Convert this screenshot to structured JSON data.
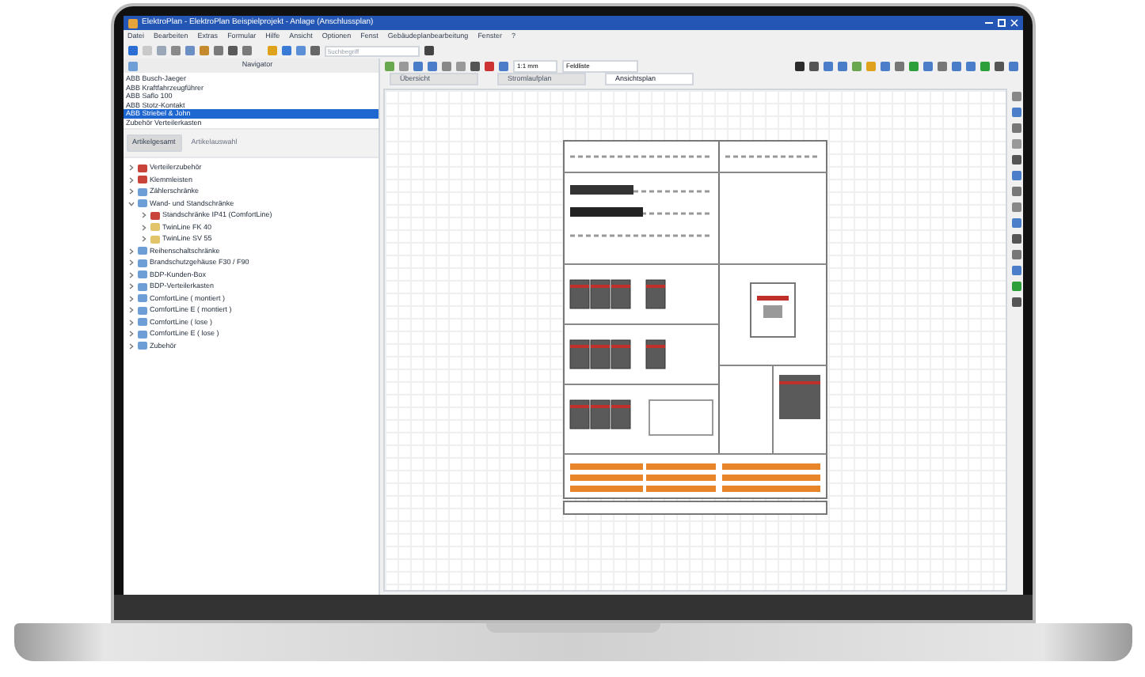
{
  "window": {
    "title": "ElektroPlan - ElektroPlan Beispielprojekt - Anlage (Anschlussplan)"
  },
  "menu": [
    "Datei",
    "Bearbeiten",
    "Extras",
    "Formular",
    "Hilfe",
    "Ansicht",
    "Optionen",
    "Fenst",
    "Gebäudeplanbearbeitung",
    "Fenster",
    "?"
  ],
  "toolbar": {
    "field_placeholder": "Suchbegriff",
    "scale": "1:1 mm",
    "view": "Feldliste"
  },
  "navigator": {
    "title": "Navigator",
    "items": [
      {
        "label": "ABB Busch-Jaeger",
        "selected": false
      },
      {
        "label": "ABB Kraftfahrzeugführer",
        "selected": false
      },
      {
        "label": "ABB Saflo 100",
        "selected": false
      },
      {
        "label": "ABB Stotz-Kontakt",
        "selected": false
      },
      {
        "label": "ABB Striebel & John",
        "selected": true
      },
      {
        "label": "Zubehör Verteilerkasten",
        "selected": false
      }
    ],
    "buttons": [
      {
        "label": "Artikelgesamt",
        "disabled": false
      },
      {
        "label": "Artikelauswahl",
        "disabled": true
      }
    ],
    "tree": [
      {
        "label": "Verteilerzubehör",
        "kind": "component",
        "expanded": false
      },
      {
        "label": "Klemmleisten",
        "kind": "component",
        "expanded": false
      },
      {
        "label": "Zählerschränke",
        "kind": "folder",
        "expanded": false
      },
      {
        "label": "Wand- und Standschränke",
        "kind": "folder",
        "expanded": true,
        "children": [
          {
            "label": "Standschränke IP41 (ComfortLine)",
            "kind": "component",
            "expanded": false
          },
          {
            "label": "TwinLine FK 40",
            "kind": "module",
            "expanded": false
          },
          {
            "label": "TwinLine SV 55",
            "kind": "module",
            "expanded": false
          }
        ]
      },
      {
        "label": "Reihenschaltschränke",
        "kind": "folder",
        "expanded": false
      },
      {
        "label": "Brandschutzgehäuse F30 / F90",
        "kind": "folder",
        "expanded": false
      },
      {
        "label": "BDP-Kunden-Box",
        "kind": "folder",
        "expanded": false
      },
      {
        "label": "BDP-Verteilerkasten",
        "kind": "folder",
        "expanded": false
      },
      {
        "label": "ComfortLine ( montiert )",
        "kind": "folder",
        "expanded": false
      },
      {
        "label": "ComfortLine E ( montiert )",
        "kind": "folder",
        "expanded": false
      },
      {
        "label": "ComfortLine ( lose )",
        "kind": "folder",
        "expanded": false
      },
      {
        "label": "ComfortLine E ( lose )",
        "kind": "folder",
        "expanded": false
      },
      {
        "label": "Zubehör",
        "kind": "folder",
        "expanded": false
      }
    ]
  },
  "tabs": [
    {
      "label": "Übersicht",
      "selected": false
    },
    {
      "label": "Stromlaufplan",
      "selected": false
    },
    {
      "label": "Ansichtsplan",
      "selected": true
    }
  ]
}
